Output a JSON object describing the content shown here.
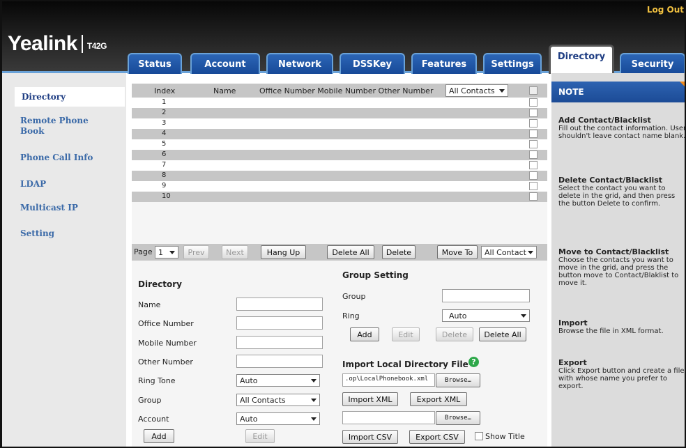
{
  "header": {
    "logout": "Log Out",
    "logo": "Yealink",
    "model": "T42G"
  },
  "tabs": [
    {
      "label": "Status"
    },
    {
      "label": "Account"
    },
    {
      "label": "Network"
    },
    {
      "label": "DSSKey"
    },
    {
      "label": "Features"
    },
    {
      "label": "Settings"
    },
    {
      "label": "Directory",
      "active": true
    },
    {
      "label": "Security"
    }
  ],
  "sidebar": {
    "items": [
      {
        "label": "Directory"
      },
      {
        "label": "Remote Phone Book"
      },
      {
        "label": "Phone Call Info"
      },
      {
        "label": "LDAP"
      },
      {
        "label": "Multicast IP"
      },
      {
        "label": "Setting"
      }
    ]
  },
  "grid": {
    "columns": {
      "index": "Index",
      "name": "Name",
      "numbers": "Office Number Mobile Number Other Number"
    },
    "filter": "All Contacts",
    "rows": [
      "1",
      "2",
      "3",
      "4",
      "5",
      "6",
      "7",
      "8",
      "9",
      "10"
    ]
  },
  "pager": {
    "page_label": "Page",
    "page_value": "1",
    "prev": "Prev",
    "next": "Next",
    "hang_up": "Hang Up",
    "delete_all": "Delete All",
    "delete": "Delete",
    "move_to": "Move To",
    "move_target": "All Contact"
  },
  "directory_form": {
    "title": "Directory",
    "name_label": "Name",
    "office_label": "Office Number",
    "mobile_label": "Mobile Number",
    "other_label": "Other Number",
    "ring_tone_label": "Ring Tone",
    "ring_tone_value": "Auto",
    "group_label": "Group",
    "group_value": "All Contacts",
    "account_label": "Account",
    "account_value": "Auto",
    "add": "Add",
    "edit": "Edit"
  },
  "group_setting": {
    "title": "Group Setting",
    "group_label": "Group",
    "ring_label": "Ring",
    "ring_value": "Auto",
    "add": "Add",
    "edit": "Edit",
    "delete": "Delete",
    "delete_all": "Delete All"
  },
  "import_local": {
    "title": "Import Local Directory File",
    "help": "?",
    "file_path": ".op\\LocalPhonebook.xml",
    "browse": "Browse…",
    "import_xml": "Import XML",
    "export_xml": "Export XML",
    "browse2": "Browse…",
    "import_csv": "Import CSV",
    "export_csv": "Export CSV",
    "show_title": "Show Title"
  },
  "note": {
    "title": "NOTE",
    "sections": [
      {
        "title": "Add Contact/Blacklist",
        "text": "Fill out the contact information. User shouldn't leave contact name blank."
      },
      {
        "title": "Delete Contact/Blacklist",
        "text": "Select the contact you want to delete in the grid, and then press the button Delete to confirm."
      },
      {
        "title": "Move to Contact/Blacklist",
        "text": "Choose the contacts you want to move in the grid, and press the button move to Contact/Blaklist to move it."
      },
      {
        "title": "Import",
        "text": "Browse the file in XML format."
      },
      {
        "title": "Export",
        "text": "Click Export button and create a file with whose name you prefer to export."
      }
    ]
  },
  "colors": {
    "tab_blue": "#1d4f9e",
    "link_blue": "#3b6aa8",
    "logout_gold": "#f0c040",
    "note_corner": "#f08a1c",
    "help_green": "#2ea84a"
  }
}
